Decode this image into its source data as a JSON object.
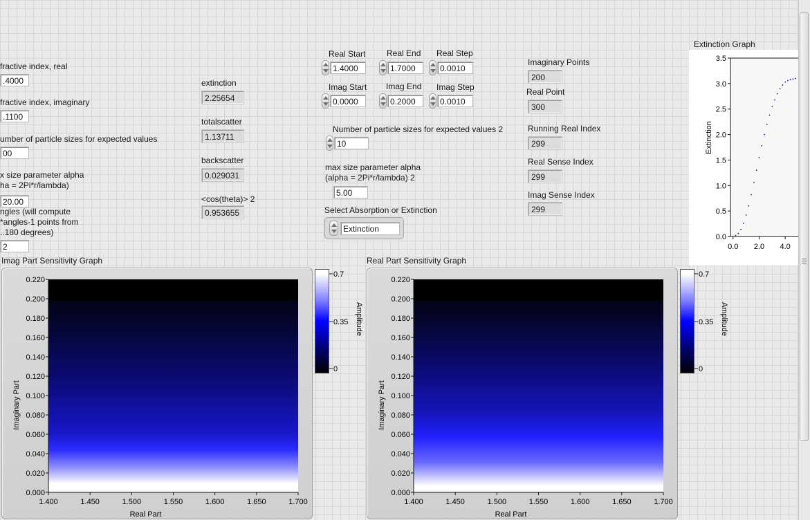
{
  "left": {
    "refr_real_label": "fractive index, real",
    "refr_real_value": ".4000",
    "refr_imag_label": "fractive index, imaginary",
    "refr_imag_value": ".1100",
    "num_sizes_label": "umber of particle sizes for expected values",
    "num_sizes_value": "00",
    "alpha_label_1": "x size parameter alpha",
    "alpha_label_2": "ha = 2Pi*r/lambda)",
    "alpha_value": "20.00",
    "angles_label_1": "ngles (will compute",
    "angles_label_2": "*angles-1 points from",
    "angles_label_3": "..180 degrees)",
    "angles_value": "2"
  },
  "mid": {
    "extinction_label": "extinction",
    "extinction_value": "2.25654",
    "totalscatter_label": "totalscatter",
    "totalscatter_value": "1.13711",
    "backscatter_label": "backscatter",
    "backscatter_value": "0.029031",
    "cos_label": "<cos(theta)> 2",
    "cos_value": "0.953655"
  },
  "range": {
    "real_start_label": "Real Start",
    "real_start": "1.4000",
    "real_end_label": "Real End",
    "real_end": "1.7000",
    "real_step_label": "Real Step",
    "real_step": "0.0010",
    "imag_start_label": "Imag Start",
    "imag_start": "0.0000",
    "imag_end_label": "Imag End",
    "imag_end": "0.2000",
    "imag_step_label": "Imag Step",
    "imag_step": "0.0010",
    "num_sizes2_label": "Number of particle sizes for expected values 2",
    "num_sizes2_value": "10",
    "alpha2_label_1": "max size parameter alpha",
    "alpha2_label_2": "(alpha = 2Pi*r/lambda) 2",
    "alpha2_value": "5.00",
    "select_label": "Select Absorption or Extinction",
    "select_value": "Extinction"
  },
  "indices": {
    "imag_points_label": "Imaginary Points",
    "imag_points": "200",
    "real_point_label": "Real Point",
    "real_point": "300",
    "running_real_label": "Running Real Index",
    "running_real": "299",
    "real_sense_label": "Real Sense Index",
    "real_sense": "299",
    "imag_sense_label": "Imag Sense Index",
    "imag_sense": "299"
  },
  "colors": {
    "colormap_low": "#000000",
    "colormap_mid": "#0000ff",
    "colormap_high": "#ffffff"
  },
  "chart_data": [
    {
      "type": "heatmap",
      "title": "Imag Part Sensitivity Graph",
      "xlabel": "Real Part",
      "ylabel": "Imaginary Part",
      "xlim": [
        1.4,
        1.7
      ],
      "ylim": [
        0.0,
        0.22
      ],
      "x_ticks": [
        "1.400",
        "1.450",
        "1.500",
        "1.550",
        "1.600",
        "1.650",
        "1.700"
      ],
      "y_ticks": [
        "0.000",
        "0.020",
        "0.040",
        "0.060",
        "0.080",
        "0.100",
        "0.120",
        "0.140",
        "0.160",
        "0.180",
        "0.200",
        "0.220"
      ],
      "colorbar": {
        "label": "Amplitude",
        "ticks": [
          "0.7",
          "0.35",
          "0"
        ]
      },
      "data_extent_imag_max": 0.2
    },
    {
      "type": "heatmap",
      "title": "Real Part Sensitivity Graph",
      "xlabel": "Real Part",
      "ylabel": "Imaginary Part",
      "xlim": [
        1.4,
        1.7
      ],
      "ylim": [
        0.0,
        0.22
      ],
      "x_ticks": [
        "1.400",
        "1.450",
        "1.500",
        "1.550",
        "1.600",
        "1.650",
        "1.700"
      ],
      "y_ticks": [
        "0.000",
        "0.020",
        "0.040",
        "0.060",
        "0.080",
        "0.100",
        "0.120",
        "0.140",
        "0.160",
        "0.180",
        "0.200",
        "0.220"
      ],
      "colorbar": {
        "label": "Amplitude",
        "ticks": [
          "0.7",
          "0.35",
          "0"
        ]
      },
      "data_extent_imag_max": 0.2
    },
    {
      "type": "scatter",
      "title": "Extinction Graph",
      "ylabel": "Extinction",
      "xlim": [
        -0.2,
        5.0
      ],
      "ylim": [
        0.0,
        3.5
      ],
      "x_ticks": [
        "0.0",
        "2.0",
        "4.0"
      ],
      "y_ticks": [
        "0.0",
        "0.5",
        "1.0",
        "1.5",
        "2.0",
        "2.5",
        "3.0",
        "3.5"
      ],
      "x": [
        0.2,
        0.4,
        0.6,
        0.8,
        1.0,
        1.2,
        1.4,
        1.6,
        1.8,
        2.0,
        2.2,
        2.4,
        2.6,
        2.8,
        3.0,
        3.2,
        3.4,
        3.6,
        3.8,
        4.0,
        4.2,
        4.4,
        4.6,
        4.8
      ],
      "y": [
        0.02,
        0.06,
        0.14,
        0.26,
        0.42,
        0.6,
        0.82,
        1.06,
        1.3,
        1.55,
        1.78,
        2.0,
        2.2,
        2.38,
        2.55,
        2.68,
        2.8,
        2.9,
        2.97,
        3.03,
        3.06,
        3.08,
        3.09,
        3.1
      ]
    }
  ]
}
